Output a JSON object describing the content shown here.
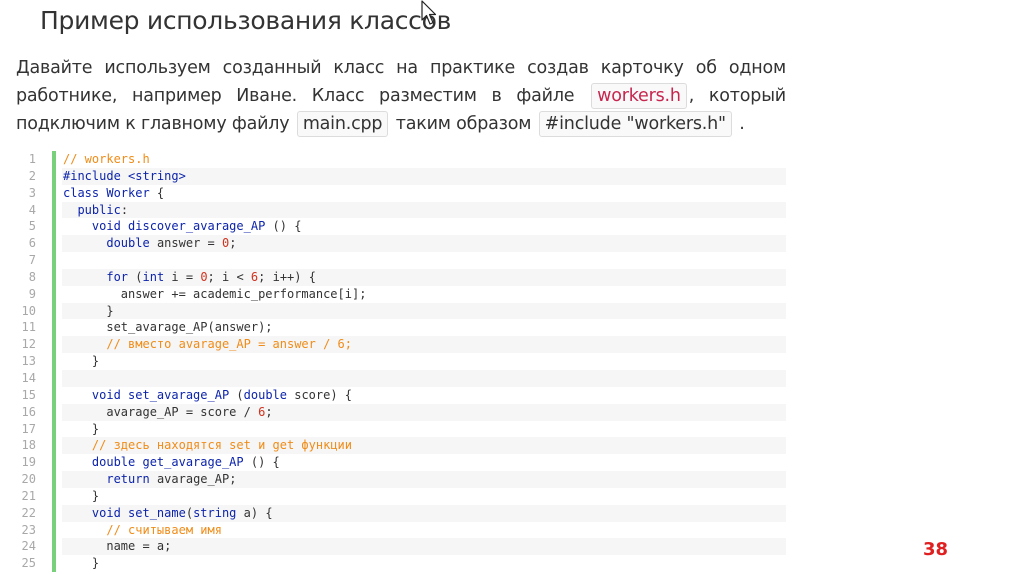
{
  "slide": {
    "title": "Пример использования классов",
    "para": {
      "t1": "Давайте используем созданный класс на практике создав карточку об одном работнике, например Иване. Класс разместим в файле",
      "file1": "workers.h",
      "t2": ", который подключим к главному файлу",
      "file2": "main.cpp",
      "t3": "таким образом",
      "directive": "#include \"workers.h\"",
      "t4": "."
    },
    "page_number": "38"
  },
  "code": {
    "colors": {
      "keyword": "#0d24ac",
      "comment": "#f08c18",
      "number": "#d0321e",
      "text": "#333333",
      "gutter_bar": "#78d17a"
    },
    "lines": [
      {
        "n": "1",
        "tokens": [
          [
            "c",
            "// workers.h"
          ]
        ]
      },
      {
        "n": "2",
        "tokens": [
          [
            "k",
            "#include <string>"
          ]
        ]
      },
      {
        "n": "3",
        "tokens": [
          [
            "k",
            "class Worker"
          ],
          [
            "p",
            " {"
          ]
        ]
      },
      {
        "n": "4",
        "tokens": [
          [
            "p",
            "  "
          ],
          [
            "k",
            "public"
          ],
          [
            "p",
            ":"
          ]
        ]
      },
      {
        "n": "5",
        "tokens": [
          [
            "p",
            "    "
          ],
          [
            "k",
            "void discover_avarage_AP"
          ],
          [
            "p",
            " () {"
          ]
        ]
      },
      {
        "n": "6",
        "tokens": [
          [
            "p",
            "      "
          ],
          [
            "k",
            "double"
          ],
          [
            "p",
            " answer = "
          ],
          [
            "n",
            "0"
          ],
          [
            "p",
            ";"
          ]
        ]
      },
      {
        "n": "7",
        "tokens": [
          [
            "p",
            ""
          ]
        ]
      },
      {
        "n": "8",
        "tokens": [
          [
            "p",
            "      "
          ],
          [
            "k",
            "for"
          ],
          [
            "p",
            " ("
          ],
          [
            "k",
            "int"
          ],
          [
            "p",
            " i = "
          ],
          [
            "n",
            "0"
          ],
          [
            "p",
            "; i < "
          ],
          [
            "n",
            "6"
          ],
          [
            "p",
            "; i++) {"
          ]
        ]
      },
      {
        "n": "9",
        "tokens": [
          [
            "p",
            "        answer += academic_performance[i];"
          ]
        ]
      },
      {
        "n": "10",
        "tokens": [
          [
            "p",
            "      }"
          ]
        ]
      },
      {
        "n": "11",
        "tokens": [
          [
            "p",
            "      set_avarage_AP(answer);"
          ]
        ]
      },
      {
        "n": "12",
        "tokens": [
          [
            "p",
            "      "
          ],
          [
            "c",
            "// вместо avarage_AP = answer / 6;"
          ]
        ]
      },
      {
        "n": "13",
        "tokens": [
          [
            "p",
            "    }"
          ]
        ]
      },
      {
        "n": "14",
        "tokens": [
          [
            "p",
            ""
          ]
        ]
      },
      {
        "n": "15",
        "tokens": [
          [
            "p",
            "    "
          ],
          [
            "k",
            "void set_avarage_AP"
          ],
          [
            "p",
            " ("
          ],
          [
            "k",
            "double"
          ],
          [
            "p",
            " score) {"
          ]
        ]
      },
      {
        "n": "16",
        "tokens": [
          [
            "p",
            "      avarage_AP = score / "
          ],
          [
            "n",
            "6"
          ],
          [
            "p",
            ";"
          ]
        ]
      },
      {
        "n": "17",
        "tokens": [
          [
            "p",
            "    }"
          ]
        ]
      },
      {
        "n": "18",
        "tokens": [
          [
            "p",
            "    "
          ],
          [
            "c",
            "// здесь находятся set и get функции"
          ]
        ]
      },
      {
        "n": "19",
        "tokens": [
          [
            "p",
            "    "
          ],
          [
            "k",
            "double get_avarage_AP"
          ],
          [
            "p",
            " () {"
          ]
        ]
      },
      {
        "n": "20",
        "tokens": [
          [
            "p",
            "      "
          ],
          [
            "k",
            "return"
          ],
          [
            "p",
            " avarage_AP;"
          ]
        ]
      },
      {
        "n": "21",
        "tokens": [
          [
            "p",
            "    }"
          ]
        ]
      },
      {
        "n": "22",
        "tokens": [
          [
            "p",
            "    "
          ],
          [
            "k",
            "void set_name"
          ],
          [
            "p",
            "("
          ],
          [
            "k",
            "string"
          ],
          [
            "p",
            " a) {"
          ]
        ]
      },
      {
        "n": "23",
        "tokens": [
          [
            "p",
            "      "
          ],
          [
            "c",
            "// считываем имя"
          ]
        ]
      },
      {
        "n": "24",
        "tokens": [
          [
            "p",
            "      name = a;"
          ]
        ]
      },
      {
        "n": "25",
        "tokens": [
          [
            "p",
            "    }"
          ]
        ]
      }
    ]
  }
}
